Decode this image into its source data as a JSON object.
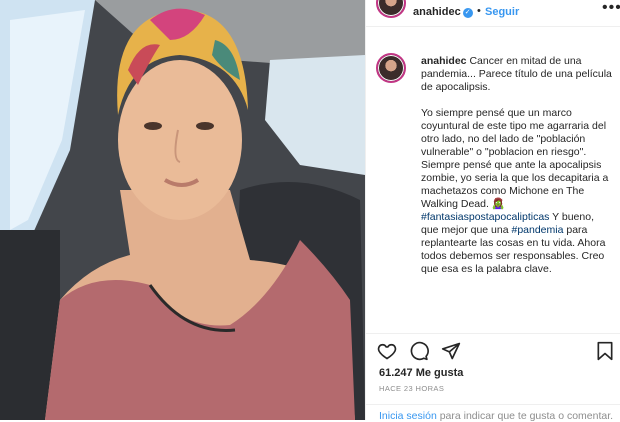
{
  "post": {
    "username": "anahidec",
    "verified_mark": "✓",
    "follow_label": "Seguir",
    "more_icon": "more-horizontal-icon"
  },
  "caption": {
    "paragraphs": [
      [
        {
          "t": "Cancer en mitad de una pandemia... Parece título de una película de apocalipsis."
        }
      ],
      [
        {
          "t": "Yo siempre pensé que un marco coyuntural de este tipo me agarraria del otro lado, no del lado de \"población vulnerable\" o \"poblacion en riesgo\". Siempre pensé que ante la apocalipsis zombie, yo seria la que los decapitaria a machetazos como Michone en The Walking Dead. 🧟‍♀️ "
        },
        {
          "t": "#fantasiaspostapocalipticas",
          "tag": true
        },
        {
          "t": " Y bueno, que mejor que una "
        },
        {
          "t": "#pandemia",
          "tag": true
        },
        {
          "t": " para replantearte las cosas en tu vida. Ahora todos debemos ser responsables. Creo que esa es la palabra clave."
        }
      ]
    ]
  },
  "actions": {
    "icons": [
      "heart-icon",
      "comment-icon",
      "share-icon",
      "bookmark-icon"
    ]
  },
  "likes": "61.247 Me gusta",
  "timestamp": "HACE 23 HORAS",
  "footer": {
    "login_link": "Inicia sesión",
    "login_rest": " para indicar que te gusta o comentar."
  },
  "colors": {
    "link_blue": "#3897f0",
    "hashtag": "#00376b",
    "muted": "#8e8e8e"
  }
}
